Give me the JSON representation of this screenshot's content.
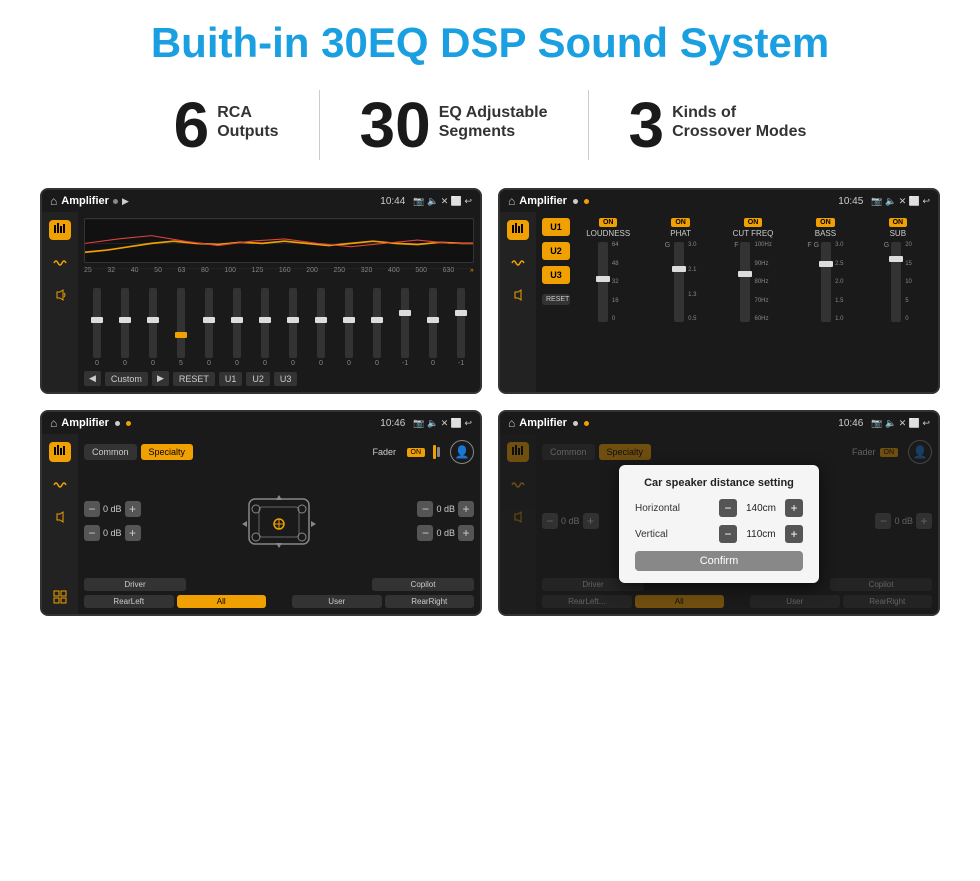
{
  "title": "Buith-in 30EQ DSP Sound System",
  "stats": [
    {
      "number": "6",
      "label1": "RCA",
      "label2": "Outputs"
    },
    {
      "number": "30",
      "label1": "EQ Adjustable",
      "label2": "Segments"
    },
    {
      "number": "3",
      "label1": "Kinds of",
      "label2": "Crossover Modes"
    }
  ],
  "screens": [
    {
      "id": "eq-screen",
      "statusBar": {
        "title": "Amplifier",
        "time": "10:44"
      },
      "type": "equalizer",
      "freqLabels": [
        "25",
        "32",
        "40",
        "50",
        "63",
        "80",
        "100",
        "125",
        "160",
        "200",
        "250",
        "320",
        "400",
        "500",
        "630"
      ],
      "sliderValues": [
        "0",
        "0",
        "0",
        "5",
        "0",
        "0",
        "0",
        "0",
        "0",
        "0",
        "0",
        "-1",
        "0",
        "-1"
      ],
      "bottomBtns": [
        "Custom",
        "RESET",
        "U1",
        "U2",
        "U3"
      ]
    },
    {
      "id": "crossover-screen",
      "statusBar": {
        "title": "Amplifier",
        "time": "10:45"
      },
      "type": "crossover",
      "presets": [
        "U1",
        "U2",
        "U3"
      ],
      "controls": [
        {
          "on": true,
          "label": "LOUDNESS"
        },
        {
          "on": true,
          "label": "PHAT"
        },
        {
          "on": true,
          "label": "CUT FREQ"
        },
        {
          "on": true,
          "label": "BASS"
        },
        {
          "on": true,
          "label": "SUB"
        }
      ],
      "resetLabel": "RESET"
    },
    {
      "id": "fader-screen",
      "statusBar": {
        "title": "Amplifier",
        "time": "10:46"
      },
      "type": "fader",
      "tabs": [
        "Common",
        "Specialty"
      ],
      "activeTab": "Specialty",
      "faderLabel": "Fader",
      "faderOn": true,
      "volumeRows": [
        {
          "value": "0 dB"
        },
        {
          "value": "0 dB"
        },
        {
          "value": "0 dB"
        },
        {
          "value": "0 dB"
        }
      ],
      "bottomBtns": [
        "Driver",
        "",
        "",
        "",
        "Copilot"
      ],
      "bottomBtns2": [
        "RearLeft",
        "All",
        "",
        "User",
        "RearRight"
      ]
    },
    {
      "id": "dialog-screen",
      "statusBar": {
        "title": "Amplifier",
        "time": "10:46"
      },
      "type": "dialog",
      "tabs": [
        "Common",
        "Specialty"
      ],
      "dialog": {
        "title": "Car speaker distance setting",
        "horizontal": {
          "label": "Horizontal",
          "value": "140cm"
        },
        "vertical": {
          "label": "Vertical",
          "value": "110cm"
        },
        "confirmLabel": "Confirm"
      },
      "volumeRows": [
        {
          "value": "0 dB"
        },
        {
          "value": "0 dB"
        }
      ]
    }
  ]
}
